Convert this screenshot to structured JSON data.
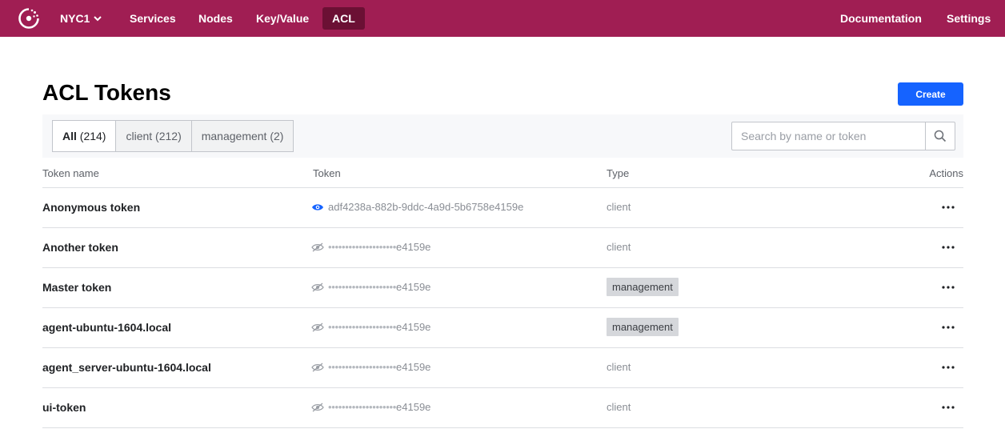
{
  "header": {
    "datacenter": "NYC1",
    "nav": [
      {
        "label": "Services"
      },
      {
        "label": "Nodes"
      },
      {
        "label": "Key/Value"
      },
      {
        "label": "ACL",
        "active": true
      }
    ],
    "right_links": [
      {
        "label": "Documentation"
      },
      {
        "label": "Settings"
      }
    ],
    "brand_color": "#a01e53",
    "active_nav_color": "#6b1034"
  },
  "page": {
    "title": "ACL Tokens",
    "create_label": "Create"
  },
  "filters": {
    "tabs": [
      {
        "label": "All",
        "count": "(214)",
        "active": true
      },
      {
        "label": "client",
        "count": "(212)"
      },
      {
        "label": "management",
        "count": "(2)"
      }
    ],
    "search_placeholder": "Search by name or token"
  },
  "table": {
    "columns": [
      "Token name",
      "Token",
      "Type",
      "Actions"
    ],
    "rows": [
      {
        "name": "Anonymous token",
        "token": "adf4238a-882b-9ddc-4a9d-5b6758e4159e",
        "token_hidden": false,
        "type": "client"
      },
      {
        "name": "Another token",
        "token_mask": "••••••••••••••••••••",
        "token_suffix": "e4159e",
        "token_hidden": true,
        "type": "client"
      },
      {
        "name": "Master token",
        "token_mask": "••••••••••••••••••••",
        "token_suffix": "e4159e",
        "token_hidden": true,
        "type": "management"
      },
      {
        "name": "agent-ubuntu-1604.local",
        "token_mask": "••••••••••••••••••••",
        "token_suffix": "e4159e",
        "token_hidden": true,
        "type": "management"
      },
      {
        "name": "agent_server-ubuntu-1604.local",
        "token_mask": "••••••••••••••••••••",
        "token_suffix": "e4159e",
        "token_hidden": true,
        "type": "client"
      },
      {
        "name": "ui-token",
        "token_mask": "••••••••••••••••••••",
        "token_suffix": "e4159e",
        "token_hidden": true,
        "type": "client"
      }
    ]
  },
  "icons": {
    "logo": "consul-logo-icon",
    "dc_toggle": "chevron-down-icon",
    "search": "search-icon",
    "token_visible": "eye-icon",
    "token_hidden": "eye-slash-icon",
    "actions": "more-horizontal-icon"
  },
  "colors": {
    "primary_button": "#1563ff",
    "visible_eye": "#1563ff",
    "management_badge": "#d5d7db"
  }
}
